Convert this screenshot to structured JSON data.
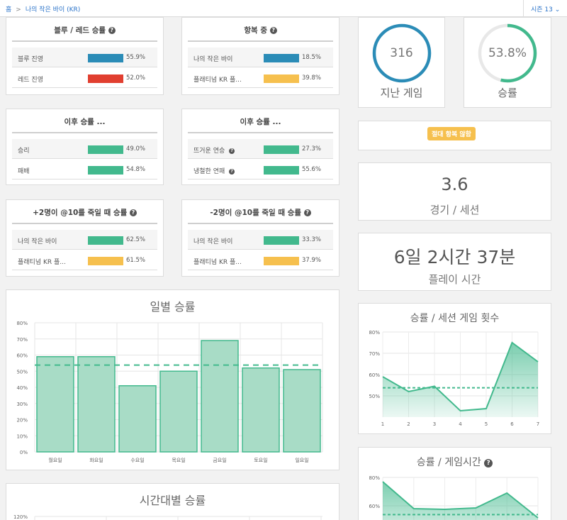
{
  "header": {
    "home": "홈",
    "sep": ">",
    "player": "나의 작은 바이 (KR)",
    "season": "시즌 13 ⌄"
  },
  "colors": {
    "blue": "#2b8cb7",
    "red": "#e13f30",
    "green": "#42b98d",
    "yellow": "#f6c04e",
    "badge": "#f6c04e"
  },
  "cards": {
    "blue_red": {
      "title": "블루 / 레드 승률",
      "rows": [
        {
          "label": "블루 진영",
          "value": "55.9%",
          "color": "blue"
        },
        {
          "label": "레드 진영",
          "value": "52.0%",
          "color": "red"
        }
      ]
    },
    "surrender": {
      "title": "항복 중",
      "rows": [
        {
          "label": "나의 작은 바이",
          "value": "18.5%",
          "color": "blue"
        },
        {
          "label": "플래티넘 KR 플...",
          "value": "39.8%",
          "color": "yellow"
        }
      ]
    },
    "after1": {
      "title": "이후 승률 ...",
      "rows": [
        {
          "label": "승리",
          "value": "49.0%",
          "color": "green"
        },
        {
          "label": "패배",
          "value": "54.8%",
          "color": "green"
        }
      ]
    },
    "after2": {
      "title": "이후 승률 ...",
      "rows": [
        {
          "label": "뜨거운 연승",
          "value": "27.3%",
          "color": "green"
        },
        {
          "label": "냉철한 연패",
          "value": "55.6%",
          "color": "green"
        }
      ]
    },
    "plus2": {
      "title": "+2명이 @10를 죽일 때 승률",
      "rows": [
        {
          "label": "나의 작은 바이",
          "value": "62.5%",
          "color": "green"
        },
        {
          "label": "플래티넘 KR 플...",
          "value": "61.5%",
          "color": "yellow"
        }
      ]
    },
    "minus2": {
      "title": "-2명이 @10를 죽일 때 승률",
      "rows": [
        {
          "label": "나의 작은 바이",
          "value": "33.3%",
          "color": "green"
        },
        {
          "label": "플래티넘 KR 플...",
          "value": "37.9%",
          "color": "yellow"
        }
      ]
    }
  },
  "summary": {
    "games": {
      "value": "316",
      "caption": "지난 게임"
    },
    "winrate": {
      "value": "53.8%",
      "caption": "승률",
      "fraction": 0.538
    },
    "badge": "절대 항복 않함",
    "per_session": {
      "value": "3.6",
      "caption": "경기 / 세션"
    },
    "playtime": {
      "value": "6일 2시간 37분",
      "caption": "플레이 시간"
    }
  },
  "chart_data": [
    {
      "type": "bar",
      "title": "일별 승률",
      "categories": [
        "월요일",
        "화요일",
        "수요일",
        "목요일",
        "금요일",
        "토요일",
        "일요일"
      ],
      "values": [
        59,
        59,
        41,
        50,
        69,
        52,
        51
      ],
      "yticks": [
        "0%",
        "10%",
        "20%",
        "30%",
        "40%",
        "50%",
        "60%",
        "70%",
        "80%"
      ],
      "ylim": [
        0,
        80
      ],
      "reference_line": 53.8
    },
    {
      "type": "area",
      "title": "승률 / 세션 게임 횟수",
      "x": [
        1,
        2,
        3,
        4,
        5,
        6,
        7
      ],
      "values": [
        59,
        52,
        54.5,
        43,
        44,
        75,
        66
      ],
      "yticks": [
        "50%",
        "60%",
        "70%",
        "80%"
      ],
      "ylim": [
        40,
        80
      ],
      "reference_line": 53.8
    },
    {
      "type": "area",
      "title": "승률 / 게임시간",
      "values": [
        77,
        58,
        57.5,
        58.5,
        69,
        51.5
      ],
      "yticks": [
        "60%",
        "80%"
      ],
      "ylim": [
        40,
        80
      ],
      "reference_line": 53.8
    },
    {
      "type": "bar",
      "title": "시간대별 승률",
      "yticks": [
        "120%"
      ],
      "ylim": [
        0,
        120
      ]
    }
  ]
}
